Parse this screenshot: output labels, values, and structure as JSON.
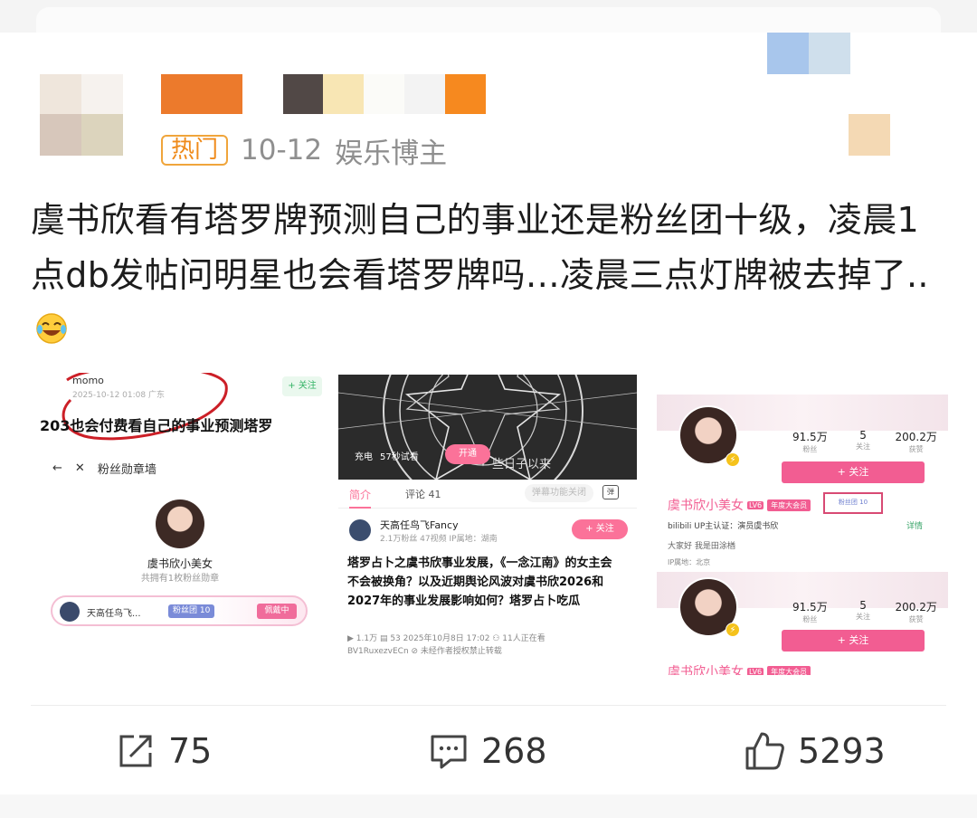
{
  "post": {
    "tag": "热门",
    "date": "10-12",
    "role": "娱乐博主",
    "text": "虞书欣看有塔罗牌预测自己的事业还是粉丝团十级，凌晨1点db发帖问明星也会看塔罗牌吗…凌晨三点灯牌被去掉了..",
    "emoji_icon": "laughing-tears-emoji"
  },
  "image1": {
    "username": "momo",
    "date": "2025-10-12 01:08 广东",
    "follow": "+ 关注",
    "headline": "203也会付费看自己的事业预测塔罗",
    "nav_back": "←",
    "nav_close": "✕",
    "nav_title": "粉丝勋章墙",
    "profile_name": "虞书欣小美女",
    "profile_sub": "共拥有1枚粉丝勋章",
    "fan_name": "天高任鸟飞...",
    "fan_level": "粉丝团 10",
    "fan_wear": "佩戴中"
  },
  "image2": {
    "charge": "充电",
    "trial": "57秒试看",
    "open": "开通",
    "overlay": "些日子以来",
    "tab_intro": "简介",
    "tab_comments": "评论 41",
    "danmu_placeholder": "弹幕功能关闭",
    "danmu_icon_text": "弹",
    "up_name": "天高任鸟飞Fancy",
    "up_sub": "2.1万粉丝   47视频   IP属地：湖南",
    "up_follow": "+ 关注",
    "title": "塔罗占卜之虞书欣事业发展，《一念江南》的女主会不会被换角？以及近期舆论风波对虞书欣2026和2027年的事业发展影响如何？塔罗占卜吃瓜",
    "stats": "▶ 1.1万  ▤ 53  2025年10月8日 17:02  ⚇ 11人正在看",
    "bv": "BV1RuxezvECn  ⊘ 未经作者授权禁止转载"
  },
  "image3": {
    "fans": "91.5万",
    "fans_label": "粉丝",
    "following": "5",
    "following_label": "关注",
    "likes": "200.2万",
    "likes_label": "获赞",
    "follow_btn": "+ 关注",
    "name": "虞书欣小美女",
    "level": "LV6",
    "vip": "年度大会员",
    "fanbox": "粉丝团 10",
    "certify": "bilibili UP主认证：演员虞书欣",
    "detail": "详情",
    "bio": "大家好 我是田涂楢",
    "ip": "IP属地：北京"
  },
  "actions": {
    "share_count": "75",
    "comment_count": "268",
    "like_count": "5293"
  },
  "colors": {
    "hot_badge": "#ef8a1a",
    "pink": "#fb7299",
    "meta_gray": "#8f8f8f"
  }
}
